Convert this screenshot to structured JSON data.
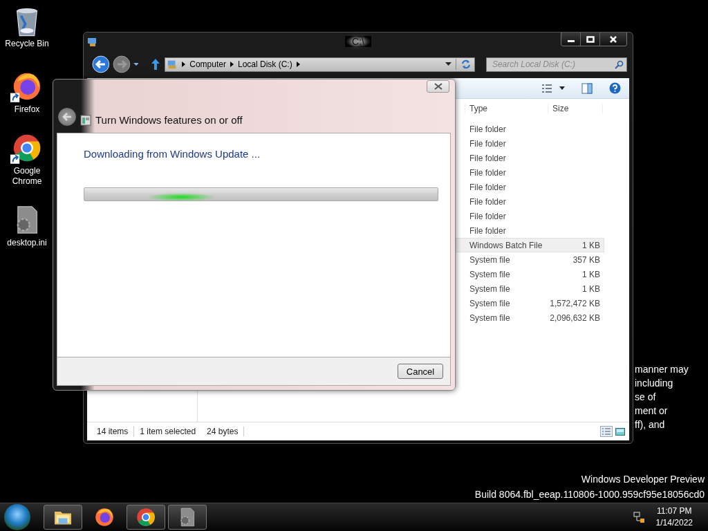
{
  "desktop_icons": [
    {
      "label": "Recycle Bin",
      "kind": "recycle-bin",
      "shortcut": false
    },
    {
      "label": "Firefox",
      "kind": "firefox",
      "shortcut": true
    },
    {
      "label": "Google Chrome",
      "kind": "chrome",
      "shortcut": true
    },
    {
      "label": "desktop.ini",
      "kind": "settings-file",
      "shortcut": false
    }
  ],
  "background_text_lines": [
    "manner may",
    "including",
    "se of",
    "ment or",
    "ff), and"
  ],
  "explorer": {
    "title": "C:\\",
    "breadcrumbs": [
      "Computer",
      "Local Disk (C:)"
    ],
    "search": {
      "placeholder": "Search Local Disk (C:)"
    },
    "columns": [
      "Type",
      "Size"
    ],
    "rows": [
      {
        "type": "File folder",
        "selected": false
      },
      {
        "type": "File folder",
        "selected": false
      },
      {
        "type": "File folder",
        "selected": false
      },
      {
        "type": "File folder",
        "selected": false
      },
      {
        "type": "File folder",
        "selected": false
      },
      {
        "type": "File folder",
        "selected": false
      },
      {
        "type": "File folder",
        "selected": false
      },
      {
        "type": "File folder",
        "selected": false
      },
      {
        "type": "Windows Batch File",
        "size": "1 KB",
        "selected": true
      },
      {
        "type": "System file",
        "size": "357 KB",
        "selected": false
      },
      {
        "type": "System file",
        "size": "1 KB",
        "selected": false
      },
      {
        "type": "System file",
        "size": "1 KB",
        "selected": false
      },
      {
        "type": "System file",
        "size": "1,572,472 KB",
        "selected": false
      },
      {
        "type": "System file",
        "size": "2,096,632 KB",
        "selected": false
      }
    ],
    "status_bar": [
      "14 items",
      "1 item selected",
      "24 bytes"
    ]
  },
  "dialog": {
    "title": "Turn Windows features on or off",
    "message": "Downloading from Windows Update ...",
    "progress": {
      "indeterminate": true
    },
    "buttons": [
      "Cancel"
    ]
  },
  "build_info": [
    "Windows Developer Preview",
    "Build 8064.fbl_eeap.110806-1000.959cf95e18056cd0"
  ],
  "taskbar": {
    "apps": [
      {
        "kind": "explorer",
        "running": true
      },
      {
        "kind": "firefox",
        "running": false
      },
      {
        "kind": "chrome",
        "running": true
      },
      {
        "kind": "settings-file",
        "running": true
      }
    ],
    "clock": {
      "time": "11:07 PM",
      "date": "1/14/2022"
    }
  }
}
